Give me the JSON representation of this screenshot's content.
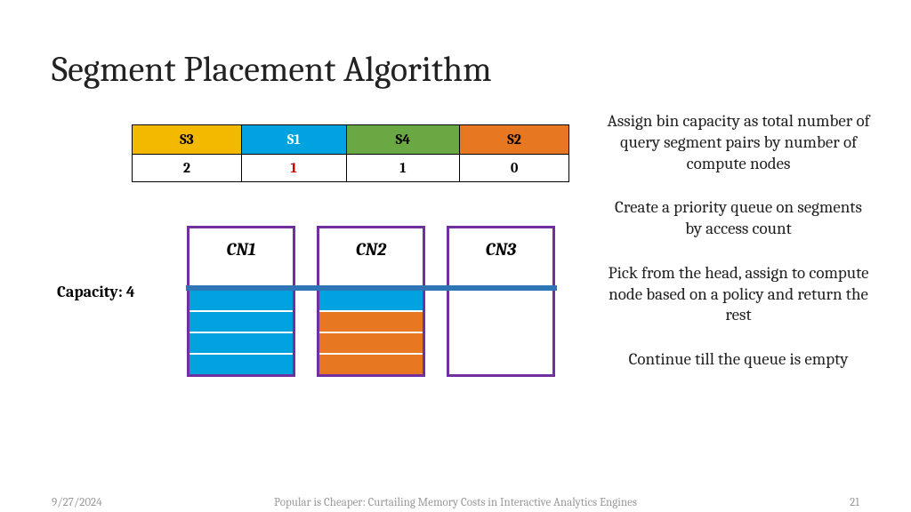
{
  "title": "Segment Placement Algorithm",
  "segments": {
    "headers": [
      {
        "label": "S3",
        "class": "c-yellow"
      },
      {
        "label": "S1",
        "class": "c-blue"
      },
      {
        "label": "S4",
        "class": "c-green"
      },
      {
        "label": "S2",
        "class": "c-orange"
      }
    ],
    "values": [
      "2",
      "1",
      "1",
      "0"
    ],
    "highlight_index": 1
  },
  "capacity_label": "Capacity: 4",
  "compute_nodes": [
    {
      "label": "CN1",
      "slots": [
        "slot-blue",
        "slot-blue",
        "slot-blue",
        "slot-blue"
      ]
    },
    {
      "label": "CN2",
      "slots": [
        "slot-blue",
        "slot-orange",
        "slot-orange",
        "slot-orange"
      ]
    },
    {
      "label": "CN3",
      "slots": []
    }
  ],
  "bullets": [
    "Assign bin capacity as total number of query segment pairs by number of compute nodes",
    "Create a priority queue on segments by access count",
    "Pick from the head, assign to compute node based on a policy and return the rest",
    "Continue till the queue is empty"
  ],
  "footer": {
    "date": "9/27/2024",
    "title": "Popular is Cheaper: Curtailing Memory Costs in Interactive Analytics Engines",
    "page": "21"
  }
}
